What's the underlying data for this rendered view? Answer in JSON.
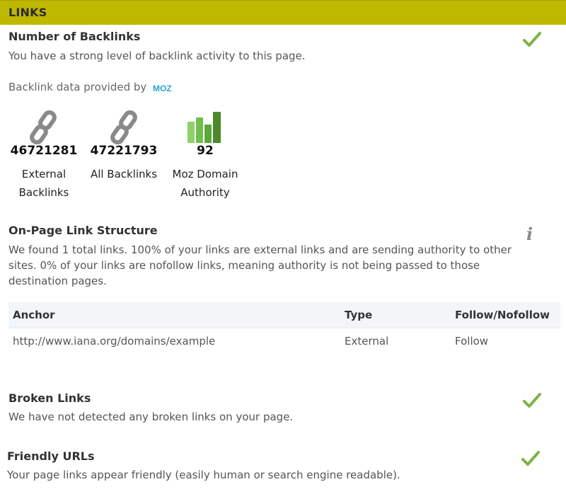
{
  "header": {
    "title": "LINKS"
  },
  "backlinks": {
    "title": "Number of Backlinks",
    "description": "You have a strong level of backlink activity to this page.",
    "provider_text": "Backlink data provided by",
    "provider_logo": "MOZ",
    "stats": [
      {
        "value": "46721281",
        "label_line1": "External",
        "label_line2": "Backlinks",
        "icon": "chain-link-icon"
      },
      {
        "value": "47221793",
        "label_line1": "All Backlinks",
        "label_line2": "",
        "icon": "chain-link-icon"
      },
      {
        "value": "92",
        "label_line1": "Moz Domain",
        "label_line2": "Authority",
        "icon": "bar-chart-icon"
      }
    ],
    "status": "pass"
  },
  "link_structure": {
    "title": "On-Page Link Structure",
    "description_lines": [
      "We found 1 total links. 100% of your links are external links and are sending authority to other",
      "sites. 0% of your links are nofollow links, meaning authority is not being passed to those",
      "destination pages."
    ],
    "table": {
      "headers": [
        "Anchor",
        "Type",
        "Follow/Nofollow"
      ],
      "rows": [
        [
          "http://www.iana.org/domains/example",
          "External",
          "Follow"
        ]
      ]
    }
  },
  "broken_links": {
    "title": "Broken Links",
    "description": "We have not detected any broken links on your page.",
    "status": "pass"
  },
  "friendly_urls": {
    "title": "Friendly URLs",
    "description": "Your page links appear friendly (easily human or search engine readable).",
    "status": "pass"
  },
  "colors": {
    "header_bg": "#bfb800",
    "check": "#7cb342",
    "moz": "#2aa5dc",
    "moz_bar_light": "#8fd16a",
    "moz_bar_dark": "#4a8a2a"
  }
}
